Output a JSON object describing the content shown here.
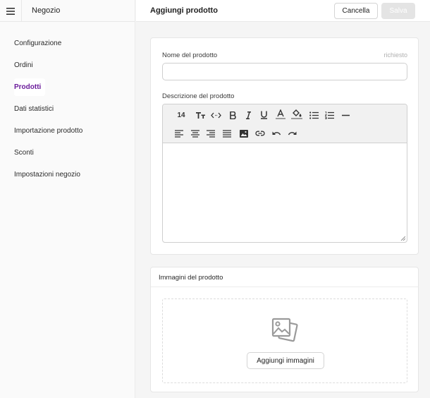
{
  "sidebar": {
    "title": "Negozio",
    "menu_icon": "hamburger-menu-icon",
    "items": [
      {
        "label": "Configurazione"
      },
      {
        "label": "Ordini"
      },
      {
        "label": "Prodotti",
        "active": true
      },
      {
        "label": "Dati statistici"
      },
      {
        "label": "Importazione prodotto"
      },
      {
        "label": "Sconti"
      },
      {
        "label": "Impostazioni negozio"
      }
    ]
  },
  "header": {
    "title": "Aggiungi prodotto",
    "cancel_label": "Cancella",
    "save_label": "Salva"
  },
  "product_form": {
    "name_label": "Nome del prodotto",
    "name_required": "richiesto",
    "name_value": "",
    "description_label": "Descrizione del prodotto",
    "font_size": "14",
    "toolbar_icons": [
      "font-size",
      "text-size-icon",
      "code-icon",
      "bold-icon",
      "italic-icon",
      "underline-icon",
      "text-color-icon",
      "highlight-color-icon",
      "bullet-list-icon",
      "numbered-list-icon",
      "horizontal-rule-icon",
      "align-left-icon",
      "align-center-icon",
      "align-right-icon",
      "align-justify-icon",
      "insert-image-icon",
      "insert-link-icon",
      "undo-icon",
      "redo-icon"
    ]
  },
  "images_section": {
    "title": "Immagini del prodotto",
    "add_button_label": "Aggiungi immagini"
  },
  "colors": {
    "accent": "#6a1b9a",
    "save_disabled": "#e4e4e4"
  }
}
